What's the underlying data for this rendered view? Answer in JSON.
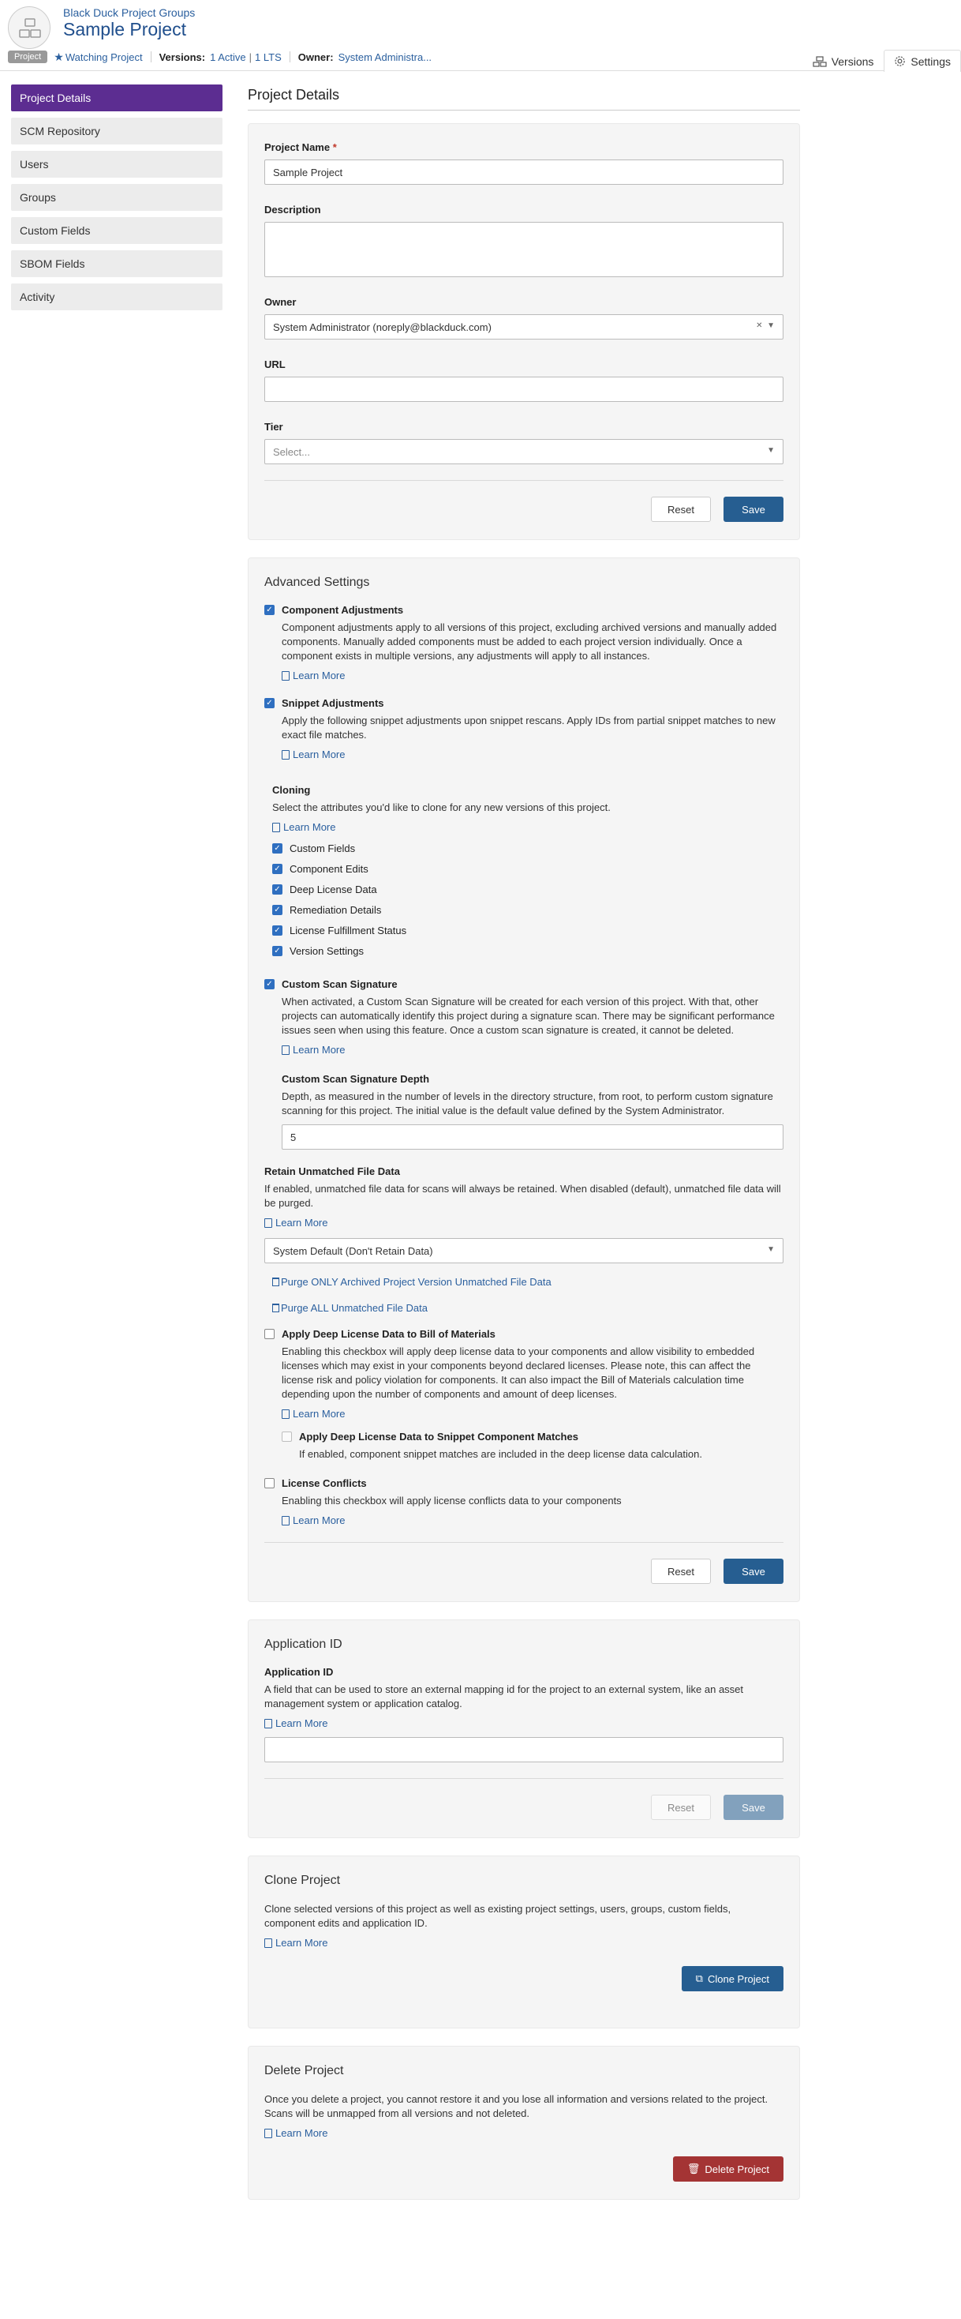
{
  "header": {
    "breadcrumb": "Black Duck Project Groups",
    "title": "Sample Project",
    "badge": "Project",
    "watching": "Watching Project",
    "versions_label": "Versions:",
    "versions_active": "1 Active",
    "versions_lts": "1 LTS",
    "owner_label": "Owner:",
    "owner_value": "System Administra...",
    "tabs": [
      {
        "label": "Versions",
        "icon": "versions-icon"
      },
      {
        "label": "Settings",
        "icon": "gear-icon"
      }
    ]
  },
  "sidebar": {
    "items": [
      {
        "label": "Project Details"
      },
      {
        "label": "SCM Repository"
      },
      {
        "label": "Users"
      },
      {
        "label": "Groups"
      },
      {
        "label": "Custom Fields"
      },
      {
        "label": "SBOM Fields"
      },
      {
        "label": "Activity"
      }
    ]
  },
  "main": {
    "page_title": "Project Details",
    "details": {
      "name_label": "Project Name",
      "name_required": "*",
      "name_value": "Sample Project",
      "description_label": "Description",
      "owner_label": "Owner",
      "owner_value": "System Administrator (noreply@blackduck.com)",
      "url_label": "URL",
      "tier_label": "Tier",
      "tier_placeholder": "Select...",
      "reset": "Reset",
      "save": "Save"
    },
    "advanced": {
      "title": "Advanced Settings",
      "learn_more": "Learn More",
      "component_adjustments": {
        "title": "Component Adjustments",
        "checked": true,
        "desc": "Component adjustments apply to all versions of this project, excluding archived versions and manually added components. Manually added components must be added to each project version individually. Once a component exists in multiple versions, any adjustments will apply to all instances."
      },
      "snippet_adjustments": {
        "title": "Snippet Adjustments",
        "checked": true,
        "desc": "Apply the following snippet adjustments upon snippet rescans. Apply IDs from partial snippet matches to new exact file matches."
      },
      "cloning": {
        "title": "Cloning",
        "desc": "Select the attributes you'd like to clone for any new versions of this project.",
        "options": [
          {
            "label": "Custom Fields",
            "checked": true
          },
          {
            "label": "Component Edits",
            "checked": true
          },
          {
            "label": "Deep License Data",
            "checked": true
          },
          {
            "label": "Remediation Details",
            "checked": true
          },
          {
            "label": "License Fulfillment Status",
            "checked": true
          },
          {
            "label": "Version Settings",
            "checked": true
          }
        ]
      },
      "custom_scan_signature": {
        "title": "Custom Scan Signature",
        "checked": true,
        "desc": "When activated, a Custom Scan Signature will be created for each version of this project. With that, other projects can automatically identify this project during a signature scan. There may be significant performance issues seen when using this feature. Once a custom scan signature is created, it cannot be deleted."
      },
      "signature_depth": {
        "title": "Custom Scan Signature Depth",
        "desc": "Depth, as measured in the number of levels in the directory structure, from root, to perform custom signature scanning for this project. The initial value is the default value defined by the System Administrator.",
        "value": "5"
      },
      "retain": {
        "title": "Retain Unmatched File Data",
        "desc": "If enabled, unmatched file data for scans will always be retained. When disabled (default), unmatched file data will be purged.",
        "select_value": "System Default (Don't Retain Data)",
        "purge_archived": "Purge ONLY Archived Project Version Unmatched File Data",
        "purge_all": "Purge ALL Unmatched File Data"
      },
      "deep_license": {
        "title": "Apply Deep License Data to Bill of Materials",
        "checked": false,
        "desc": "Enabling this checkbox will apply deep license data to your components and allow visibility to embedded licenses which may exist in your components beyond declared licenses. Please note, this can affect the license risk and policy violation for components. It can also impact the Bill of Materials calculation time depending upon the number of components and amount of deep licenses."
      },
      "deep_snippet": {
        "title": "Apply Deep License Data to Snippet Component Matches",
        "checked": false,
        "desc": "If enabled, component snippet matches are included in the deep license data calculation."
      },
      "license_conflicts": {
        "title": "License Conflicts",
        "checked": false,
        "desc": "Enabling this checkbox will apply license conflicts data to your components"
      },
      "reset": "Reset",
      "save": "Save"
    },
    "application_id": {
      "title": "Application ID",
      "label": "Application ID",
      "desc": "A field that can be used to store an external mapping id for the project to an external system, like an asset management system or application catalog.",
      "learn_more": "Learn More",
      "reset": "Reset",
      "save": "Save"
    },
    "clone": {
      "title": "Clone Project",
      "desc": "Clone selected versions of this project as well as existing project settings, users, groups, custom fields, component edits and application ID.",
      "learn_more": "Learn More",
      "button": "Clone Project"
    },
    "delete": {
      "title": "Delete Project",
      "desc": "Once you delete a project, you cannot restore it and you lose all information and versions related to the project. Scans will be unmapped from all versions and not deleted.",
      "learn_more": "Learn More",
      "button": "Delete Project"
    }
  }
}
